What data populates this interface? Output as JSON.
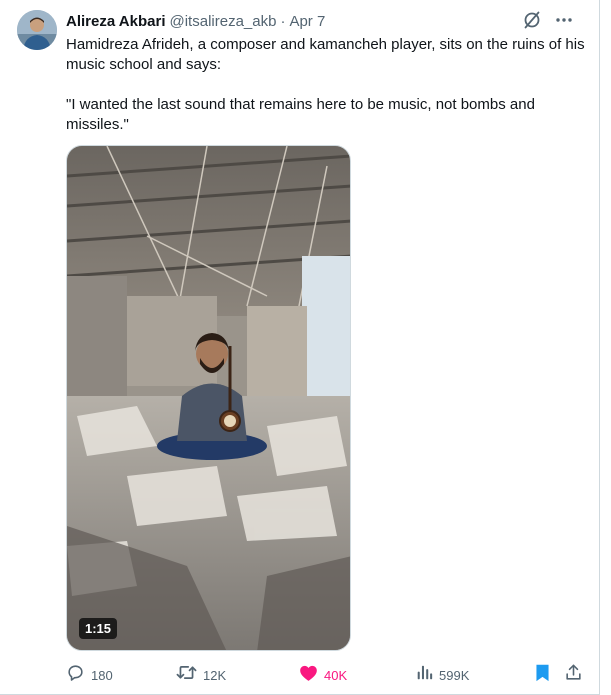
{
  "author": {
    "name": "Alireza Akbari",
    "handle": "@itsalireza_akb",
    "separator": "·",
    "date": "Apr 7"
  },
  "tweet": {
    "paragraphs": [
      "Hamidreza Afrideh, a composer and kamancheh player, sits on the ruins of his music school and says:",
      "\"I wanted the last sound that remains here to be music, not bombs and missiles.\""
    ]
  },
  "media": {
    "type": "video",
    "duration": "1:15"
  },
  "actions": {
    "replies": "180",
    "reposts": "12K",
    "likes": "40K",
    "views": "599K",
    "liked": true,
    "bookmarked": true
  },
  "colors": {
    "like": "#f91880",
    "bookmark": "#1d9bf0",
    "muted_text": "#536471",
    "grok_icon": "#536471"
  },
  "icons": [
    "grok-icon",
    "more-icon",
    "reply-icon",
    "repost-icon",
    "like-icon",
    "views-icon",
    "bookmark-icon",
    "share-icon"
  ]
}
